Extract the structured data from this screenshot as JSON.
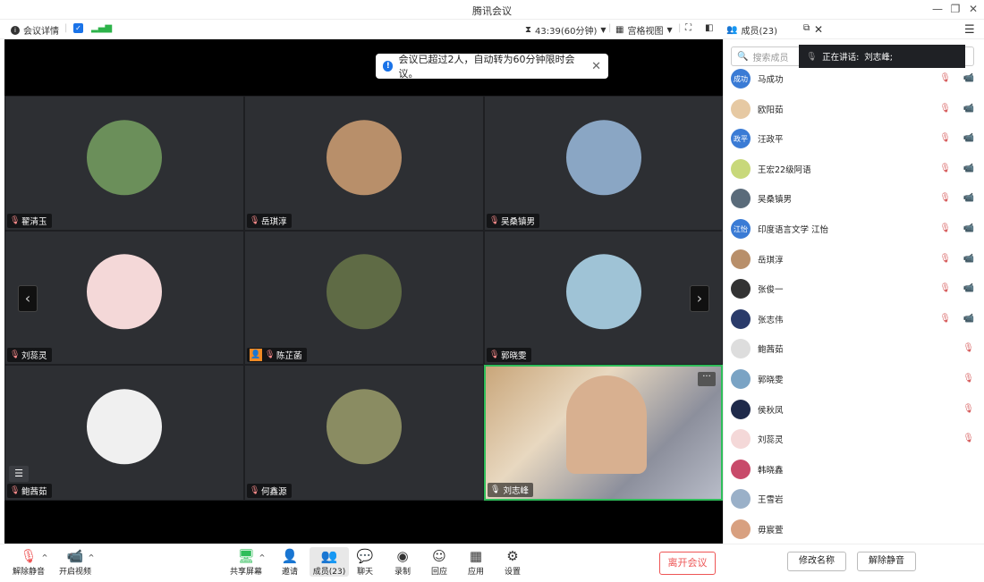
{
  "window": {
    "title": "腾讯会议"
  },
  "toolbar": {
    "meeting_details": "会议详情",
    "timer": "43:39(60分钟)",
    "view_mode": "宫格视图",
    "members": "成员(23)"
  },
  "toast": {
    "text": "会议已超过2人，自动转为60分钟限时会议。"
  },
  "tiles": [
    {
      "name": "翟清玉",
      "avatar_color": "#6b8f5a"
    },
    {
      "name": "岳琪淳",
      "avatar_color": "#b88f6a"
    },
    {
      "name": "吴桑镇男",
      "avatar_color": "#8aa6c4"
    },
    {
      "name": "刘蕊灵",
      "avatar_color": "#f4d8d8"
    },
    {
      "name": "陈芷菡",
      "avatar_color": "#5f6b45"
    },
    {
      "name": "郭晓雯",
      "avatar_color": "#9fc3d6"
    },
    {
      "name": "鲍茜茹",
      "avatar_color": "#f0f0f0"
    },
    {
      "name": "何鑫源",
      "avatar_color": "#8a8c62"
    },
    {
      "name": "刘志峰",
      "avatar_color": "#c9a67a"
    }
  ],
  "sidebar": {
    "search_placeholder": "搜索成员",
    "speaking_label": "正在讲话:",
    "speaking_name": "刘志峰;",
    "members": [
      {
        "name": "马成功",
        "avatar_text": "成功",
        "color": "#3a7bd5"
      },
      {
        "name": "欧阳茹",
        "avatar_text": "",
        "color": "#e6c9a3"
      },
      {
        "name": "汪政平",
        "avatar_text": "政平",
        "color": "#3a7bd5"
      },
      {
        "name": "王宏22级阿语",
        "avatar_text": "",
        "color": "#c8d87a"
      },
      {
        "name": "吴桑镇男",
        "avatar_text": "",
        "color": "#5a6b7a"
      },
      {
        "name": "印度语言文学 江怡",
        "avatar_text": "江怡",
        "color": "#3a7bd5"
      },
      {
        "name": "岳琪淳",
        "avatar_text": "",
        "color": "#b88f6a"
      },
      {
        "name": "张俊一",
        "avatar_text": "",
        "color": "#333"
      },
      {
        "name": "张志伟",
        "avatar_text": "",
        "color": "#2a3b6a"
      },
      {
        "name": "鲍茜茹",
        "avatar_text": "",
        "color": "#ddd"
      },
      {
        "name": "郭晓雯",
        "avatar_text": "",
        "color": "#7aa3c4"
      },
      {
        "name": "侯秋凤",
        "avatar_text": "",
        "color": "#1f2a4a"
      },
      {
        "name": "刘蕊灵",
        "avatar_text": "",
        "color": "#f4d8d8"
      },
      {
        "name": "韩晓鑫",
        "avatar_text": "",
        "color": "#c84a6a"
      },
      {
        "name": "王雪岩",
        "avatar_text": "",
        "color": "#9ab0c8"
      },
      {
        "name": "毋宸萱",
        "avatar_text": "",
        "color": "#d8a080"
      }
    ],
    "rename_label": "修改名称",
    "unmute_label": "解除静音"
  },
  "bottombar": {
    "unmute": "解除静音",
    "video": "开启视频",
    "share": "共享屏幕",
    "invite": "邀请",
    "members": "成员(23)",
    "chat": "聊天",
    "record": "录制",
    "react": "回应",
    "apps": "应用",
    "settings": "设置",
    "leave": "离开会议"
  }
}
